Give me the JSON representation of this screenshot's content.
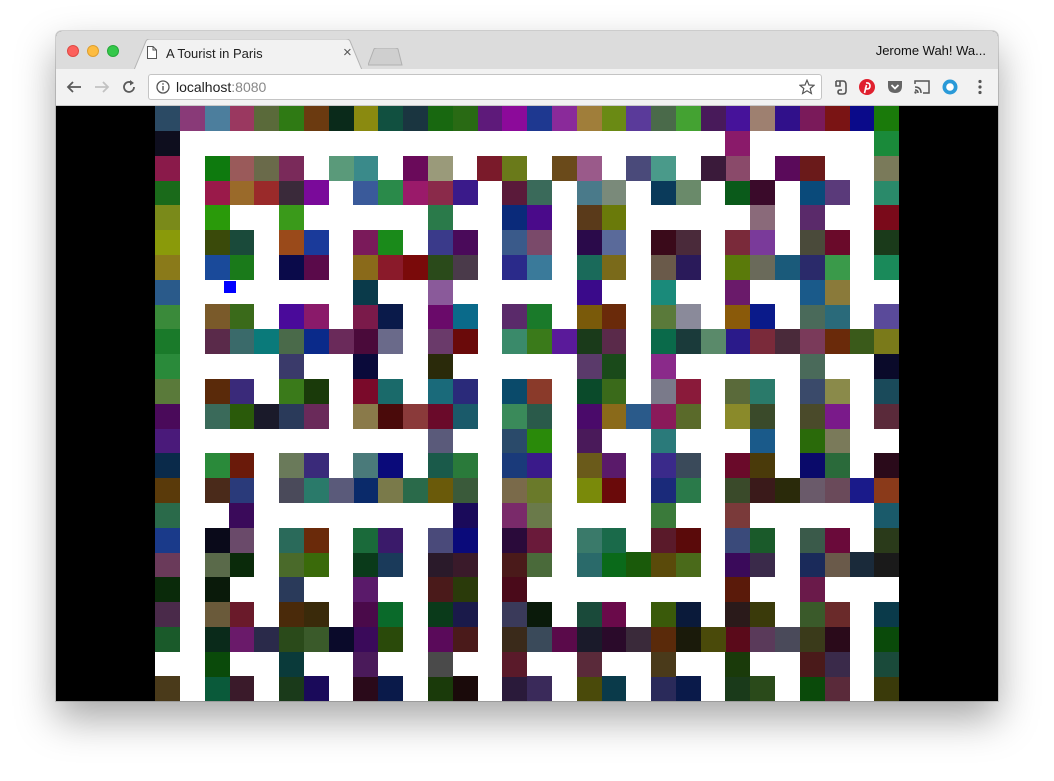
{
  "browser": {
    "tab_title": "A Tourist in Paris",
    "profile_name": "Jerome Wah! Wa...",
    "url_host": "localhost",
    "url_port": ":8080"
  },
  "game": {
    "cols": 30,
    "rows": 24,
    "player": {
      "col": 2,
      "row": 7
    },
    "player_color": "#0000ff",
    "path_color": "#ffffff",
    "rows_data": [
      "#2b4a64 #893a78 #4c7e9d #9a3860 #5a6a3a #2f7a14 #6b3a10 #0a2a1a #8a8a10 #115040 #1a3540 #186810 #296a14 #5e1a7a #8c0a9a #1e3890 #8a2a9a #a07e3a #6a8a14 #5a3a9a #4a6a4a #44a232 #481a5a #46129a #9e8070 #30108a #7a1a5a #7a1414 #0a0a8a #1a7a0a",
      "#0e0e1e #ffffff #ffffff #ffffff #ffffff #ffffff #ffffff #ffffff #ffffff #ffffff #ffffff #ffffff #ffffff #ffffff #ffffff #ffffff #ffffff #ffffff #ffffff #ffffff #ffffff #ffffff #ffffff #8a1a6a #ffffff #ffffff #ffffff #ffffff #ffffff #1a8a3a",
      "#8a1a4a #ffffff #0e7a0e #9a5a5a #6a6a4a #7a2a5a #ffffff #5a9a7a #3a8a8a #ffffff #6a0a5a #9a9a7a #ffffff #7a1a2a #6a7a1a #ffffff #6a4a1a #9a5a8a #ffffff #4a4a7a #4a9a8a #ffffff #3a1a3a #8a4a6a #ffffff #5a0a5a #6a1a1a #ffffff #ffffff #7a7a5a",
      "#1a6a1a #ffffff #9a1a4a #9a6a2a #9a2a2a #3a2a3a #7a0a9a #ffffff #3a5a9a #2a8a4a #9a1a6a #8a2a4a #3a1a8a #ffffff #5a1a3a #3a6a5a #ffffff #4a7a8a #7a8a7a #ffffff #0a3a5a #6a8a6a #ffffff #0a5a1a #3a0a2a #ffffff #0a4a7a #5a3a7a #ffffff #2a8a6a",
      "#7a8a1a #ffffff #2a9a0a #ffffff #ffffff #3a9a1a #ffffff #ffffff #ffffff #ffffff #ffffff #2a7a4a #ffffff #ffffff #0a2a7a #4a0a8a #ffffff #5a3a1a #6a7a0a #ffffff #ffffff #ffffff #ffffff #ffffff #8a6a7a #ffffff #5a2a6a #ffffff #ffffff #7a0a1a",
      "#8a9a0a #ffffff #3a4a0a #1a4a3a #ffffff #9a4a1a #1a3a9a #ffffff #7a1a5a #1a8a1a #ffffff #3a3a8a #4a0a5a #ffffff #3a5a8a #7a4a6a #ffffff #2a0a4a #5a6a9a #ffffff #3a0a1a #4a2a3a #ffffff #7a2a3a #7a3a9a #ffffff #4a4a3a #6a0a2a #ffffff #1a3a1a",
      "#8a7a1a #ffffff #1a4a9a #1a7a1a #ffffff #0a0a4a #5a0a4a #ffffff #8a6a1a #8a1a2a #7a0a0a #2a4a1a #4a3a4a #ffffff #2a2a8a #3a7a9a #ffffff #1a6a5a #7a6a1a #ffffff #6a5a4a #2a1a5a #ffffff #5a7a0a #6a6a5a #1a5a7a #2a2a6a #3a9a4a #ffffff #1a8a5a",
      "#2a5a8a #ffffff #ffffff #ffffff #ffffff #ffffff #ffffff #ffffff #0a3a4a #ffffff #ffffff #8a5a9a #ffffff #ffffff #ffffff #ffffff #ffffff #3a0a8a #ffffff #ffffff #1a8a7a #ffffff #ffffff #6a1a6a #ffffff #ffffff #1a5a8a #8a7a3a #ffffff #ffffff",
      "#3a8a3a #ffffff #7a5a2a #3a6a1a #ffffff #4a0a9a #8a1a6a #ffffff #7a1a4a #0a1a4a #ffffff #6a0a6a #0a6a8a #ffffff #5a2a6a #1a7a2a #ffffff #7a5a0a #6a2a0a #ffffff #5a7a3a #8a8a9a #ffffff #8a5a0a #0a1a8a #ffffff #4a6a5a #2a6a7a #ffffff #5a4a9a",
      "#1a7a2a #ffffff #5a2a4a #3a6a6a #0a7a7a #4a6a4a #0a2a8a #6a2a5a #4a0a3a #6a6a8a #ffffff #6a3a6a #6a0a0a #ffffff #3a8a6a #3a7a1a #5a1a9a #1a3a1a #5a2a4a #ffffff #0a6a4a #1a3a3a #5a8a6a #2a1a8a #7a2a3a #4a2a3a #7a3a5a #6a2a0a #3a5a1a #7a7a1a",
      "#2a8a3a #ffffff #ffffff #ffffff #ffffff #3a3a6a #ffffff #ffffff #0a0a3a #ffffff #ffffff #2a2a0a #ffffff #ffffff #ffffff #ffffff #ffffff #5a3a6a #1a4a1a #ffffff #8a2a8a #ffffff #ffffff #ffffff #ffffff #ffffff #4a6a5a #ffffff #ffffff #0a0a2a",
      "#5a7a3a #ffffff #5a2a0a #3a2a7a #ffffff #3a7a1a #1a3a0a #ffffff #7a0a2a #1a6a6a #ffffff #1a6a7a #2a2a7a #ffffff #0a4a6a #8a3a2a #ffffff #0a4a2a #3a6a1a #ffffff #7a7a8a #8a1a3a #ffffff #5a6a3a #2a7a6a #ffffff #3a4a6a #8a8a4a #ffffff #1a4a5a",
      "#4a0a5a #ffffff #3a6a5a #2a5a0a #1a1a2a #2a3a5a #6a2a5a #ffffff #8a7a4a #4a0a0a #8a3a3a #6a0a2a #1a5a6a #ffffff #3a8a5a #2a5a4a #ffffff #4a0a6a #8a6a1a #2a5a8a #8a1a5a #5a6a2a #ffffff #8a8a2a #3a4a2a #ffffff #4a4a2a #7a1a8a #ffffff #5a2a3a",
      "#4a1a7a #ffffff #ffffff #ffffff #ffffff #ffffff #ffffff #ffffff #ffffff #ffffff #ffffff #5a5a7a #ffffff #ffffff #2a4a6a #2a8a0a #ffffff #4a1a5a #ffffff #ffffff #2a7a7a #ffffff #ffffff #ffffff #1a5a8a #ffffff #2a6a0a #7a7a5a #ffffff #ffffff",
      "#0a2a4a #ffffff #2a8a3a #6a1a0a #ffffff #6a7a5a #3a2a7a #ffffff #4a7a7a #0a0a7a #ffffff #1a5a4a #2a7a3a #ffffff #1a3a7a #3a1a8a #ffffff #6a5a1a #5a1a6a #ffffff #3a2a8a #3a4a5a #ffffff #6a0a2a #4a3a0a #ffffff #0a0a6a #2a6a3a #ffffff #2a0a1a",
      "#5a3a0a #ffffff #4a2a1a #2a3a7a #ffffff #4a4a5a #2a7a6a #5a5a7a #0a2a6a #7a7a4a #2a6a4a #6a5a0a #3a5a3a #ffffff #7a6a4a #6a7a2a #ffffff #7a8a0a #6a0a0a #ffffff #1a2a7a #2a7a4a #ffffff #3a4a2a #3a1a1a #2a2a0a #6a5a6a #6a4a5a #1a1a8a #8a3a1a",
      "#2a6a4a #ffffff #ffffff #3a0a5a #ffffff #ffffff #ffffff #ffffff #ffffff #ffffff #ffffff #ffffff #1a0a5a #ffffff #7a2a6a #6a7a4a #ffffff #ffffff #ffffff #ffffff #3a7a3a #ffffff #ffffff #7a3a3a #ffffff #ffffff #ffffff #ffffff #ffffff #1a5a6a",
      "#1a3a8a #ffffff #0a0a1a #6a4a6a #ffffff #2a6a5a #6a2a0a #ffffff #1a6a3a #3a1a6a #ffffff #4a4a7a #0a0a7a #ffffff #2a0a3a #6a1a3a #ffffff #3a7a6a #1a6a4a #ffffff #5a1a2a #5a0a0a #ffffff #3a4a7a #1a5a2a #ffffff #3a5a4a #6a0a3a #ffffff #2a3a1a",
      "#6a3a5a #ffffff #5a6a4a #0a2a0a #ffffff #4a6a2a #3a6a0a #ffffff #0a3a1a #1a3a5a #ffffff #2a1a2a #3a1a2a #ffffff #4a1a1a #4a6a3a #ffffff #2a6a6a #0a6a1a #1a5a0a #5a4a0a #4a6a1a #ffffff #3a0a5a #3a2a4a #ffffff #1a2a5a #6a5a4a #1a2a3a #1a1a1a",
      "#0a2a0a #ffffff #0a1a0a #ffffff #ffffff #2a3a5a #ffffff #ffffff #5a1a6a #ffffff #ffffff #4a1a1a #2a3a0a #ffffff #4a0a1a #ffffff #ffffff #ffffff #ffffff #ffffff #ffffff #ffffff #ffffff #5a1a0a #ffffff #ffffff #6a1a4a #ffffff #ffffff #ffffff",
      "#4a2a4a #ffffff #6a5a3a #6a1a2a #ffffff #4a2a0a #3a2a0a #ffffff #4a0a4a #0a6a2a #ffffff #0a3a1a #1a1a4a #ffffff #3a3a5a #0a1a0a #ffffff #1a4a3a #6a0a4a #ffffff #3a5a0a #0a1a3a #ffffff #2a1a1a #3a3a0a #ffffff #3a5a2a #6a2a2a #ffffff #0a3a4a",
      "#1a5a2a #ffffff #0a2a1a #6a1a6a #2a2a4a #2a4a1a #3a5a2a #0a0a2a #3a0a5a #2a4a0a #ffffff #5a0a5a #4a1a1a #ffffff #3a2a1a #3a4a5a #5a0a4a #1a1a2a #2a0a2a #3a2a3a #5a2a0a #1a1a0a #4a4a0a #5a0a1a #5a3a5a #4a4a5a #3a3a1a #2a0a1a #ffffff #0a4a0a",
      "#ffffff #ffffff #0a4a0a #ffffff #ffffff #0a3a3a #ffffff #ffffff #4a1a5a #ffffff #ffffff #4a4a4a #ffffff #ffffff #5a1a2a #ffffff #ffffff #5a2a3a #ffffff #ffffff #4a3a1a #ffffff #ffffff #1a3a0a #ffffff #ffffff #4a1a1a #3a2a4a #ffffff #1a4a3a",
      "#4a3a1a #ffffff #0a5a3a #3a1a2a #ffffff #1a3a1a #1a0a5a #ffffff #2a0a1a #0a1a4a #ffffff #1a3a0a #1a0a0a #ffffff #2a1a3a #3a2a5a #ffffff #4a4a0a #0a3a4a #ffffff #2a2a5a #0a1a4a #ffffff #1a3a1a #2a4a1a #ffffff #0a4a0a #5a2a3a #ffffff #3a3a0a"
    ]
  }
}
